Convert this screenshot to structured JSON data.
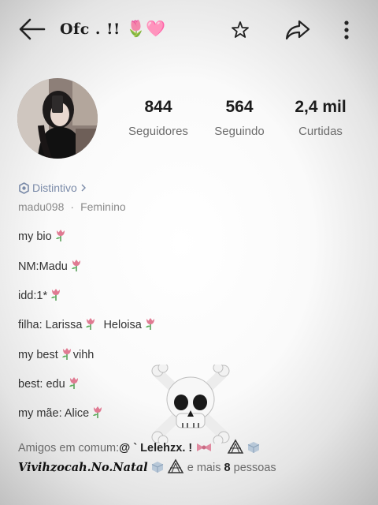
{
  "header": {
    "title": "Ofc . !!",
    "title_emoji": "🌷🩷"
  },
  "stats": [
    {
      "value": "844",
      "label": "Seguidores"
    },
    {
      "value": "564",
      "label": "Seguindo"
    },
    {
      "value": "2,4 mil",
      "label": "Curtidas"
    }
  ],
  "profile": {
    "badge": "Distintivo",
    "username": "madu098",
    "separator": "·",
    "gender": "Feminino"
  },
  "bio": [
    "my bio",
    "NM:Madu",
    "idd:1*",
    "filha: Larissa",
    "Heloisa",
    "my best",
    "vihh",
    "best: edu",
    "my mãe: Alice"
  ],
  "mutual": {
    "prefix": "Amigos em comum:",
    "first_name": "@ ` Lelehzx. !",
    "second_name": "Vivihzocah.No.Natal",
    "and_more": "e mais",
    "count": "8",
    "people": "pessoas"
  },
  "colors": {
    "accent_flower": "#e07a92",
    "badge": "#7a8aa8"
  },
  "icons": [
    "back-arrow-icon",
    "star-icon",
    "share-icon",
    "more-icon",
    "skull-crossbones-icon",
    "cube-icon",
    "triangle-eye-icon",
    "bow-icon"
  ]
}
